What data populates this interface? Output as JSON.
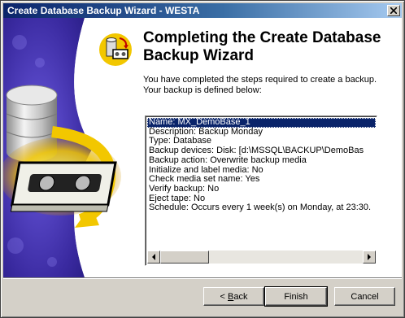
{
  "window": {
    "title": "Create Database Backup Wizard - WESTA"
  },
  "page": {
    "heading_line1": "Completing the Create Database",
    "heading_line2": "Backup Wizard",
    "desc_line1": "You have completed the steps required to create a backup.",
    "desc_line2": "Your backup is defined below:"
  },
  "summary": {
    "lines": [
      "Name:   MX_DemoBase_1",
      "Description:    Backup Monday",
      "Type:    Database",
      "Backup devices:      Disk: [d:\\MSSQL\\BACKUP\\DemoBas",
      "Backup action:     Overwrite backup media",
      "Initialize and label media:     No",
      "Check media set name:     Yes",
      "Verify backup:     No",
      "Eject tape:     No",
      "Schedule: Occurs every 1 week(s) on Monday, at 23:30."
    ],
    "selected_index": 0
  },
  "buttons": {
    "back_mnemonic": "B",
    "back_rest": "ack",
    "back_prefix": "< ",
    "finish": "Finish",
    "cancel": "Cancel"
  },
  "icons": {
    "close": "close-icon",
    "wizard": "database-backup-icon",
    "scroll_left": "arrow-left-icon",
    "scroll_right": "arrow-right-icon"
  },
  "colors": {
    "title_bar_start": "#0a246a",
    "title_bar_end": "#a6caf0",
    "selection": "#0a246a",
    "sidebar_bg": "#3a2aa0",
    "accent_yellow": "#f2c700"
  }
}
